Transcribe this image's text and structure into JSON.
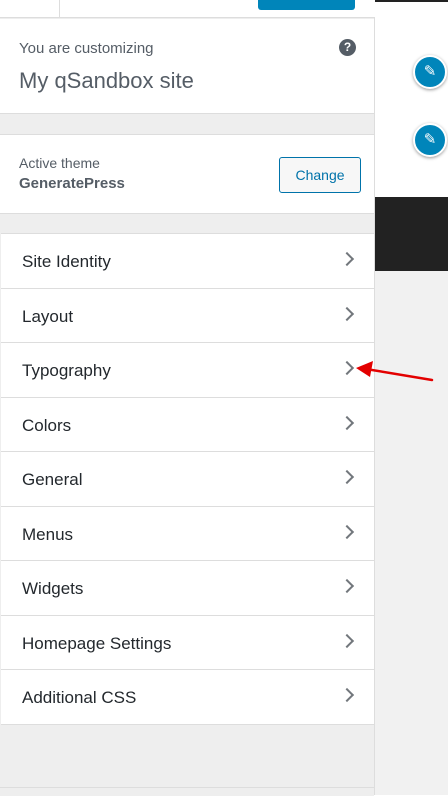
{
  "header": {
    "customizing_label": "You are customizing",
    "site_title": "My qSandbox site",
    "help_icon": "?"
  },
  "theme": {
    "label": "Active theme",
    "name": "GeneratePress",
    "change_label": "Change"
  },
  "sections": [
    {
      "label": "Site Identity"
    },
    {
      "label": "Layout"
    },
    {
      "label": "Typography"
    },
    {
      "label": "Colors"
    },
    {
      "label": "General"
    },
    {
      "label": "Menus"
    },
    {
      "label": "Widgets"
    },
    {
      "label": "Homepage Settings"
    },
    {
      "label": "Additional CSS"
    }
  ],
  "preview": {
    "edit_icon_glyph": "✎"
  },
  "colors": {
    "accent": "#0085ba",
    "annotation": "#e30000",
    "sidebar_bg": "#eeeeee",
    "text": "#23282d"
  },
  "icons": [
    "help-icon",
    "chevron-right-icon",
    "pencil-edit-icon",
    "annotation-arrow"
  ]
}
